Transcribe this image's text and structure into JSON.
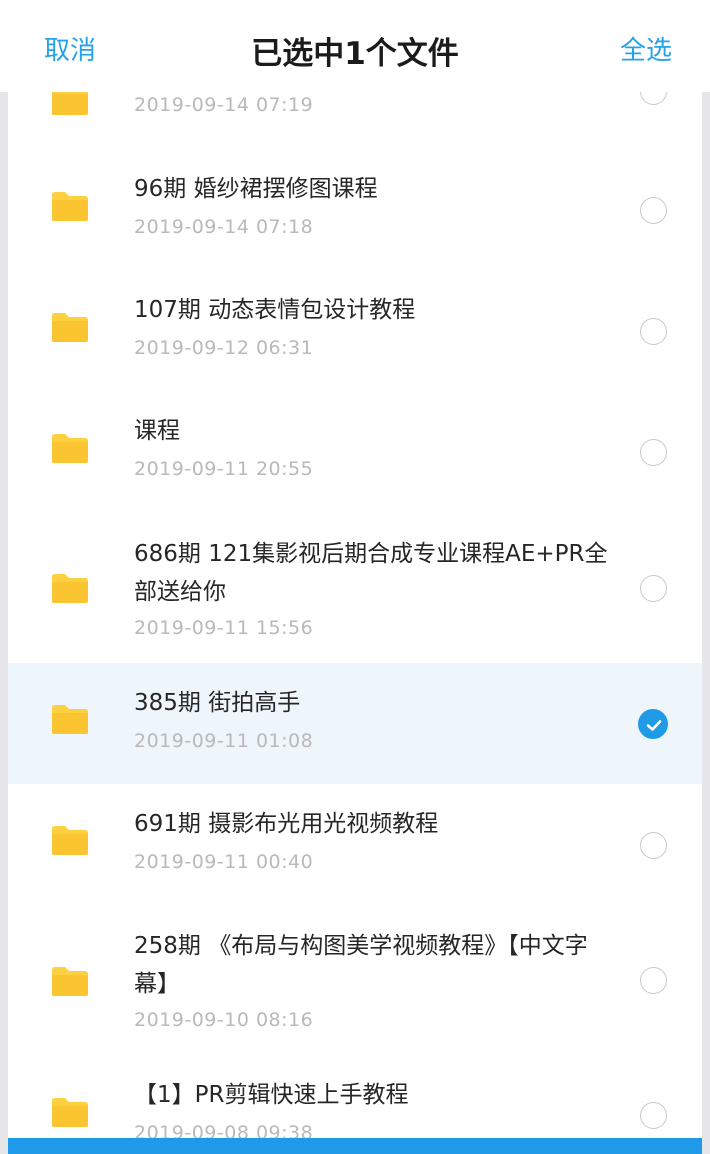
{
  "header": {
    "cancel_label": "取消",
    "title": "已选中1个文件",
    "select_all_label": "全选"
  },
  "colors": {
    "accent": "#25a3e8",
    "folder": "#fdd042",
    "selected_row_bg": "#eef5fb",
    "check_fill": "#1f9be6"
  },
  "files": [
    {
      "name": "",
      "date": "2019-09-14  07:19",
      "selected": false,
      "icon": "folder-icon"
    },
    {
      "name": "96期 婚纱裙摆修图课程",
      "date": "2019-09-14  07:18",
      "selected": false,
      "icon": "folder-icon"
    },
    {
      "name": "107期 动态表情包设计教程",
      "date": "2019-09-12  06:31",
      "selected": false,
      "icon": "folder-icon"
    },
    {
      "name": "课程",
      "date": "2019-09-11  20:55",
      "selected": false,
      "icon": "folder-icon"
    },
    {
      "name": "686期 121集影视后期合成专业课程AE+PR全部送给你",
      "date": "2019-09-11  15:56",
      "selected": false,
      "icon": "folder-icon"
    },
    {
      "name": "385期 街拍高手",
      "date": "2019-09-11  01:08",
      "selected": true,
      "icon": "folder-icon"
    },
    {
      "name": "691期 摄影布光用光视频教程",
      "date": "2019-09-11  00:40",
      "selected": false,
      "icon": "folder-icon"
    },
    {
      "name": "258期 《布局与构图美学视频教程》【中文字幕】",
      "date": "2019-09-10  08:16",
      "selected": false,
      "icon": "folder-icon"
    },
    {
      "name": "【1】PR剪辑快速上手教程",
      "date": "2019-09-08  09:38",
      "selected": false,
      "icon": "folder-icon"
    }
  ]
}
